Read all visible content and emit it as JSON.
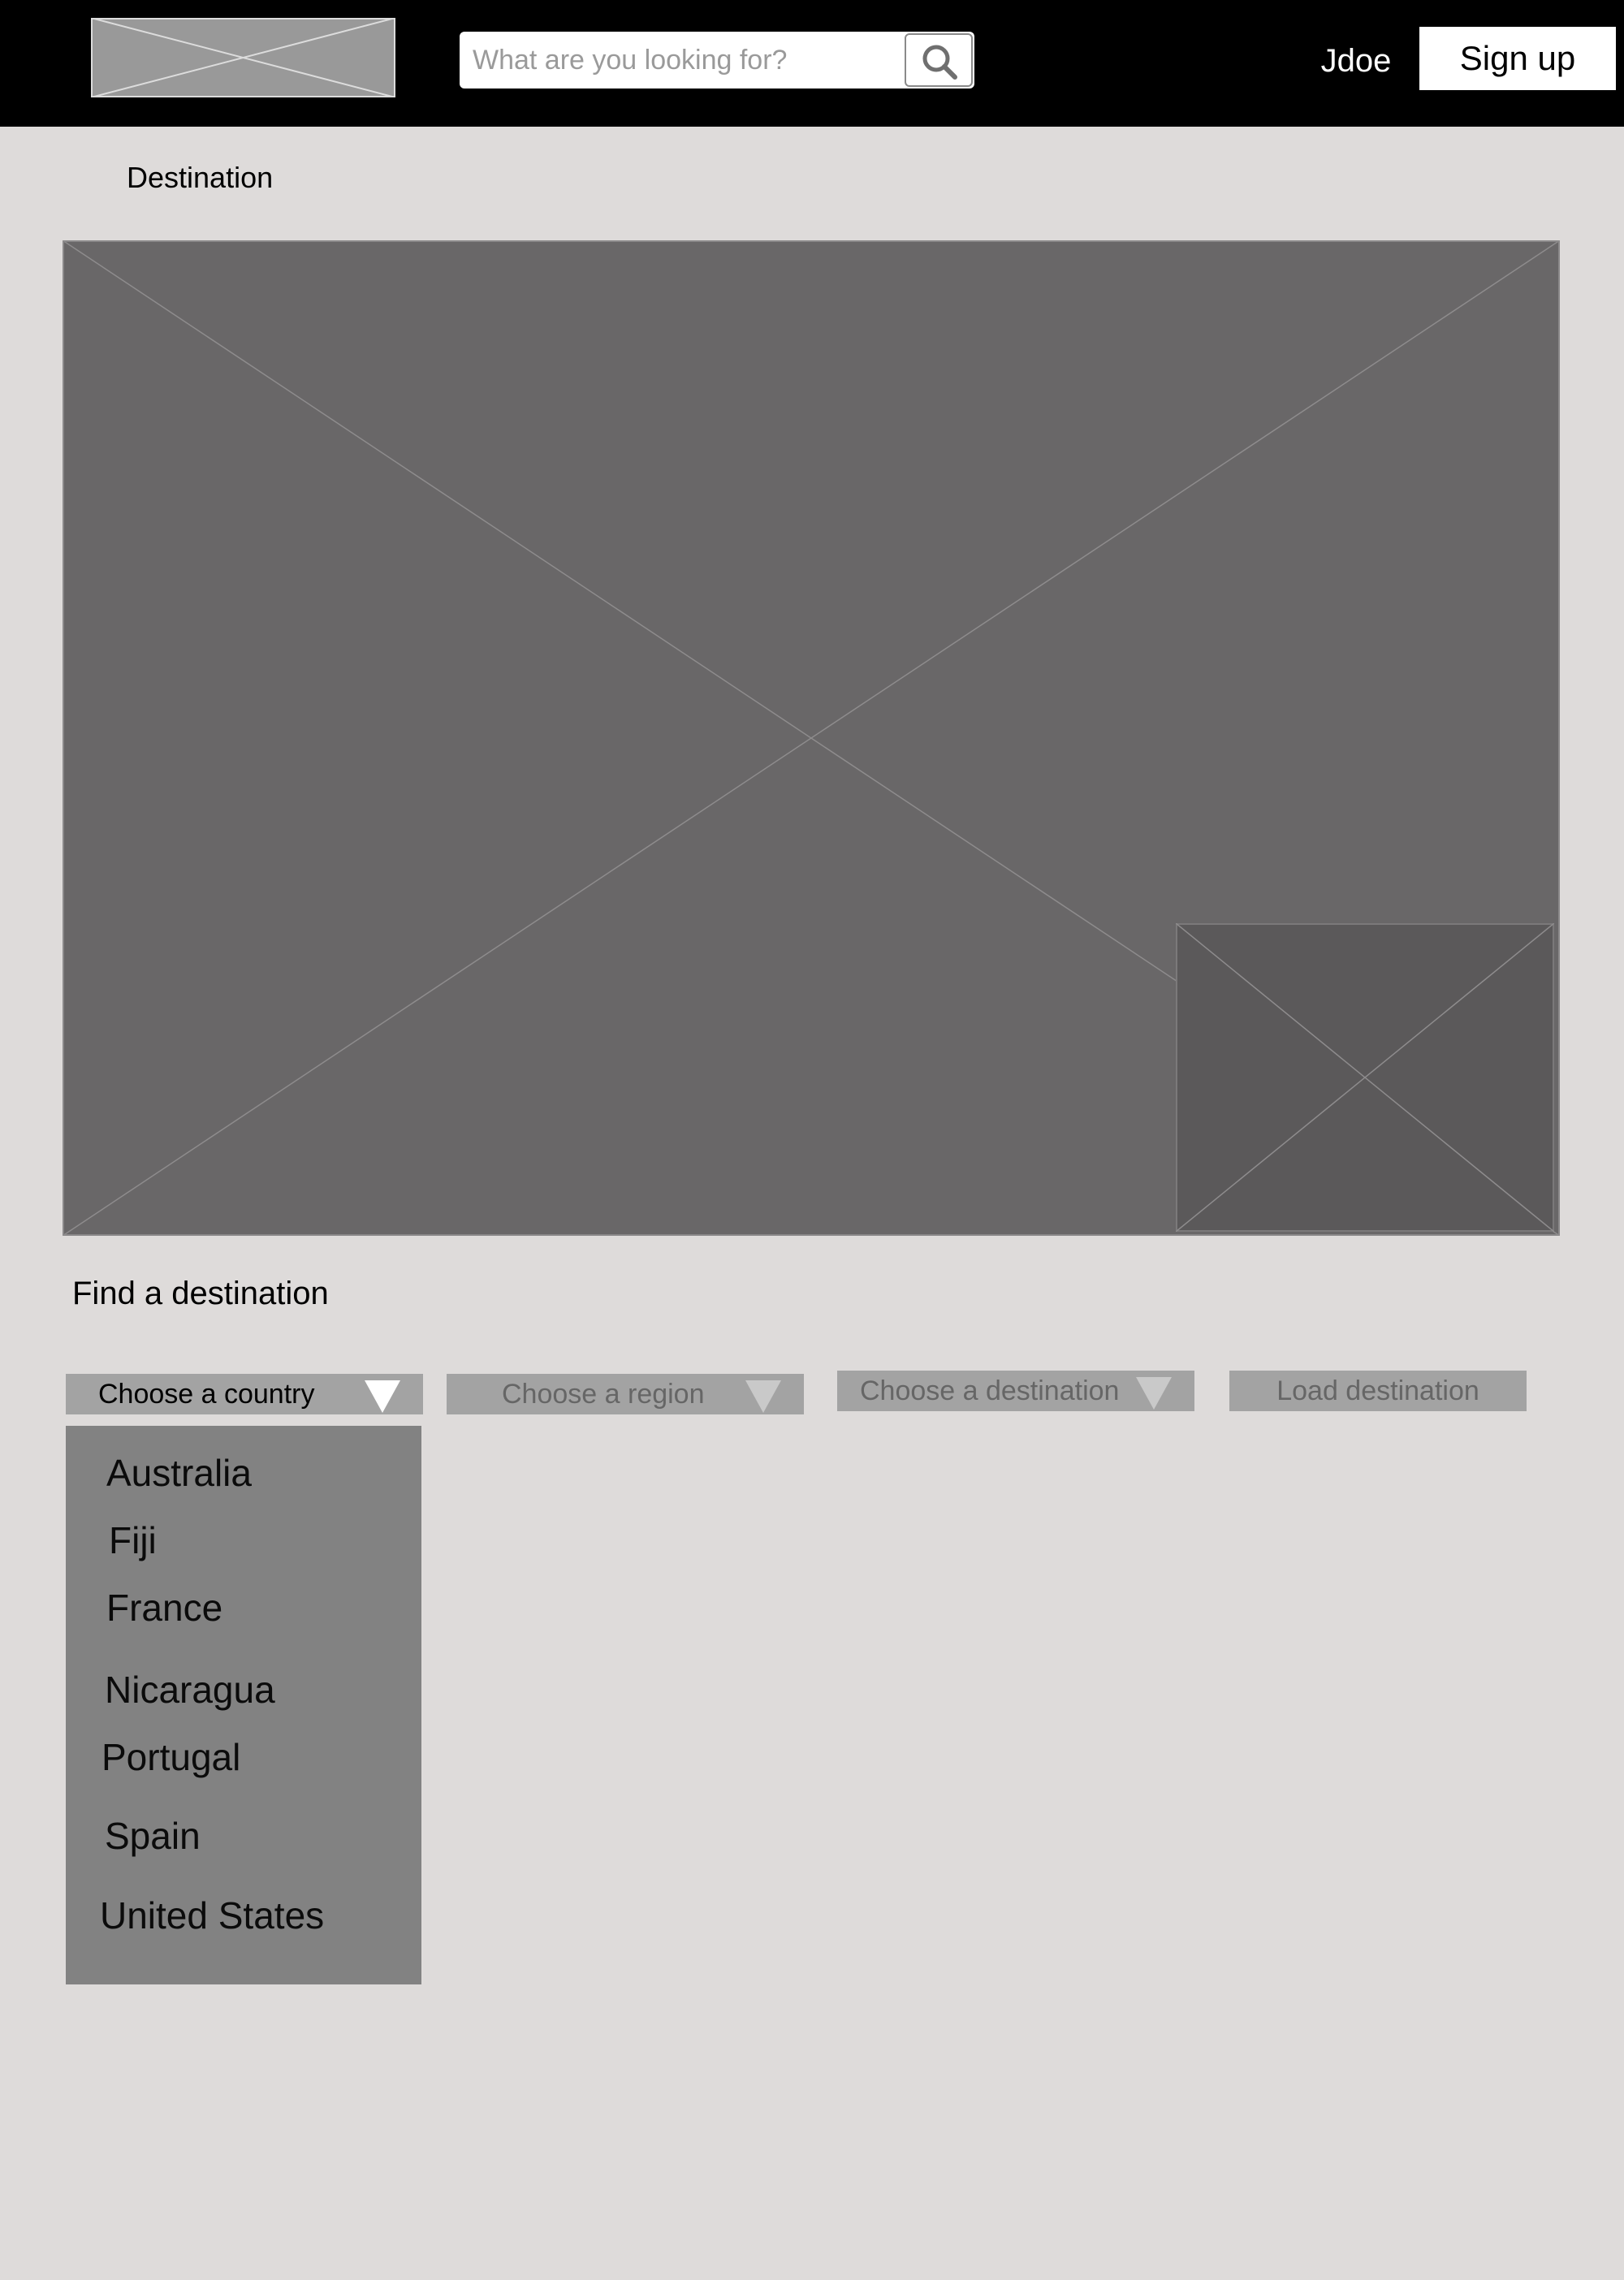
{
  "header": {
    "search": {
      "placeholder": "What are you looking for?"
    },
    "username": "Jdoe",
    "signup_label": "Sign up"
  },
  "breadcrumb": "Destination",
  "finder": {
    "title": "Find a destination",
    "country_select": "Choose a country",
    "region_select": "Choose a region",
    "destination_select": "Choose a destination",
    "load_button": "Load destination",
    "countries": [
      "Australia",
      "Fiji",
      "France",
      "Nicaragua",
      "Portugal",
      "Spain",
      "United States"
    ]
  }
}
